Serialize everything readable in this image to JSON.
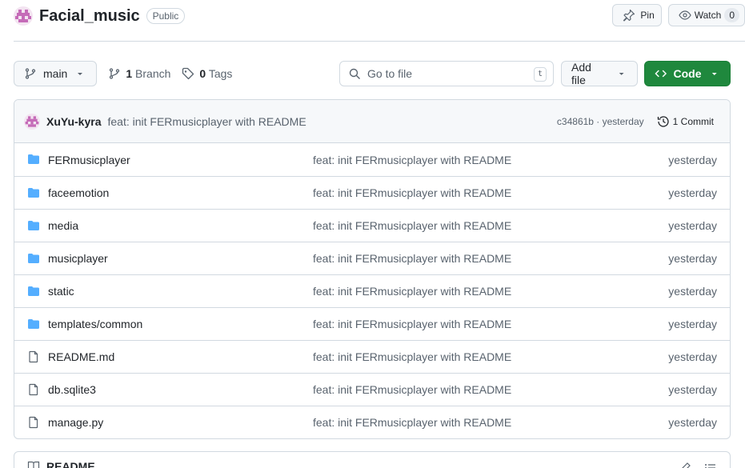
{
  "repo": {
    "name": "Facial_music",
    "visibility": "Public"
  },
  "header_actions": {
    "pin_label": "Pin",
    "watch_label": "Watch",
    "watch_count": "0"
  },
  "toolbar": {
    "branch_name": "main",
    "branch_count": "1",
    "branch_label": "Branch",
    "tag_count": "0",
    "tag_label": "Tags",
    "goto_placeholder": "Go to file",
    "goto_shortcut": "t",
    "add_file_label": "Add file",
    "code_label": "Code"
  },
  "latest_commit": {
    "author": "XuYu-kyra",
    "message": "feat: init FERmusicplayer with README",
    "hash_time": "c34861b · yesterday",
    "commits_label": "1 Commit"
  },
  "files": [
    {
      "name": "FERmusicplayer",
      "type": "folder",
      "message": "feat: init FERmusicplayer with README",
      "date": "yesterday"
    },
    {
      "name": "faceemotion",
      "type": "folder",
      "message": "feat: init FERmusicplayer with README",
      "date": "yesterday"
    },
    {
      "name": "media",
      "type": "folder",
      "message": "feat: init FERmusicplayer with README",
      "date": "yesterday"
    },
    {
      "name": "musicplayer",
      "type": "folder",
      "message": "feat: init FERmusicplayer with README",
      "date": "yesterday"
    },
    {
      "name": "static",
      "type": "folder",
      "message": "feat: init FERmusicplayer with README",
      "date": "yesterday"
    },
    {
      "name": "templates/common",
      "type": "folder",
      "message": "feat: init FERmusicplayer with README",
      "date": "yesterday"
    },
    {
      "name": "README.md",
      "type": "file",
      "message": "feat: init FERmusicplayer with README",
      "date": "yesterday"
    },
    {
      "name": "db.sqlite3",
      "type": "file",
      "message": "feat: init FERmusicplayer with README",
      "date": "yesterday"
    },
    {
      "name": "manage.py",
      "type": "file",
      "message": "feat: init FERmusicplayer with README",
      "date": "yesterday"
    }
  ],
  "readme": {
    "title": "README"
  },
  "colors": {
    "folder_icon": "#54aeff",
    "code_button": "#1f883d",
    "avatar": "#c56bb8"
  }
}
